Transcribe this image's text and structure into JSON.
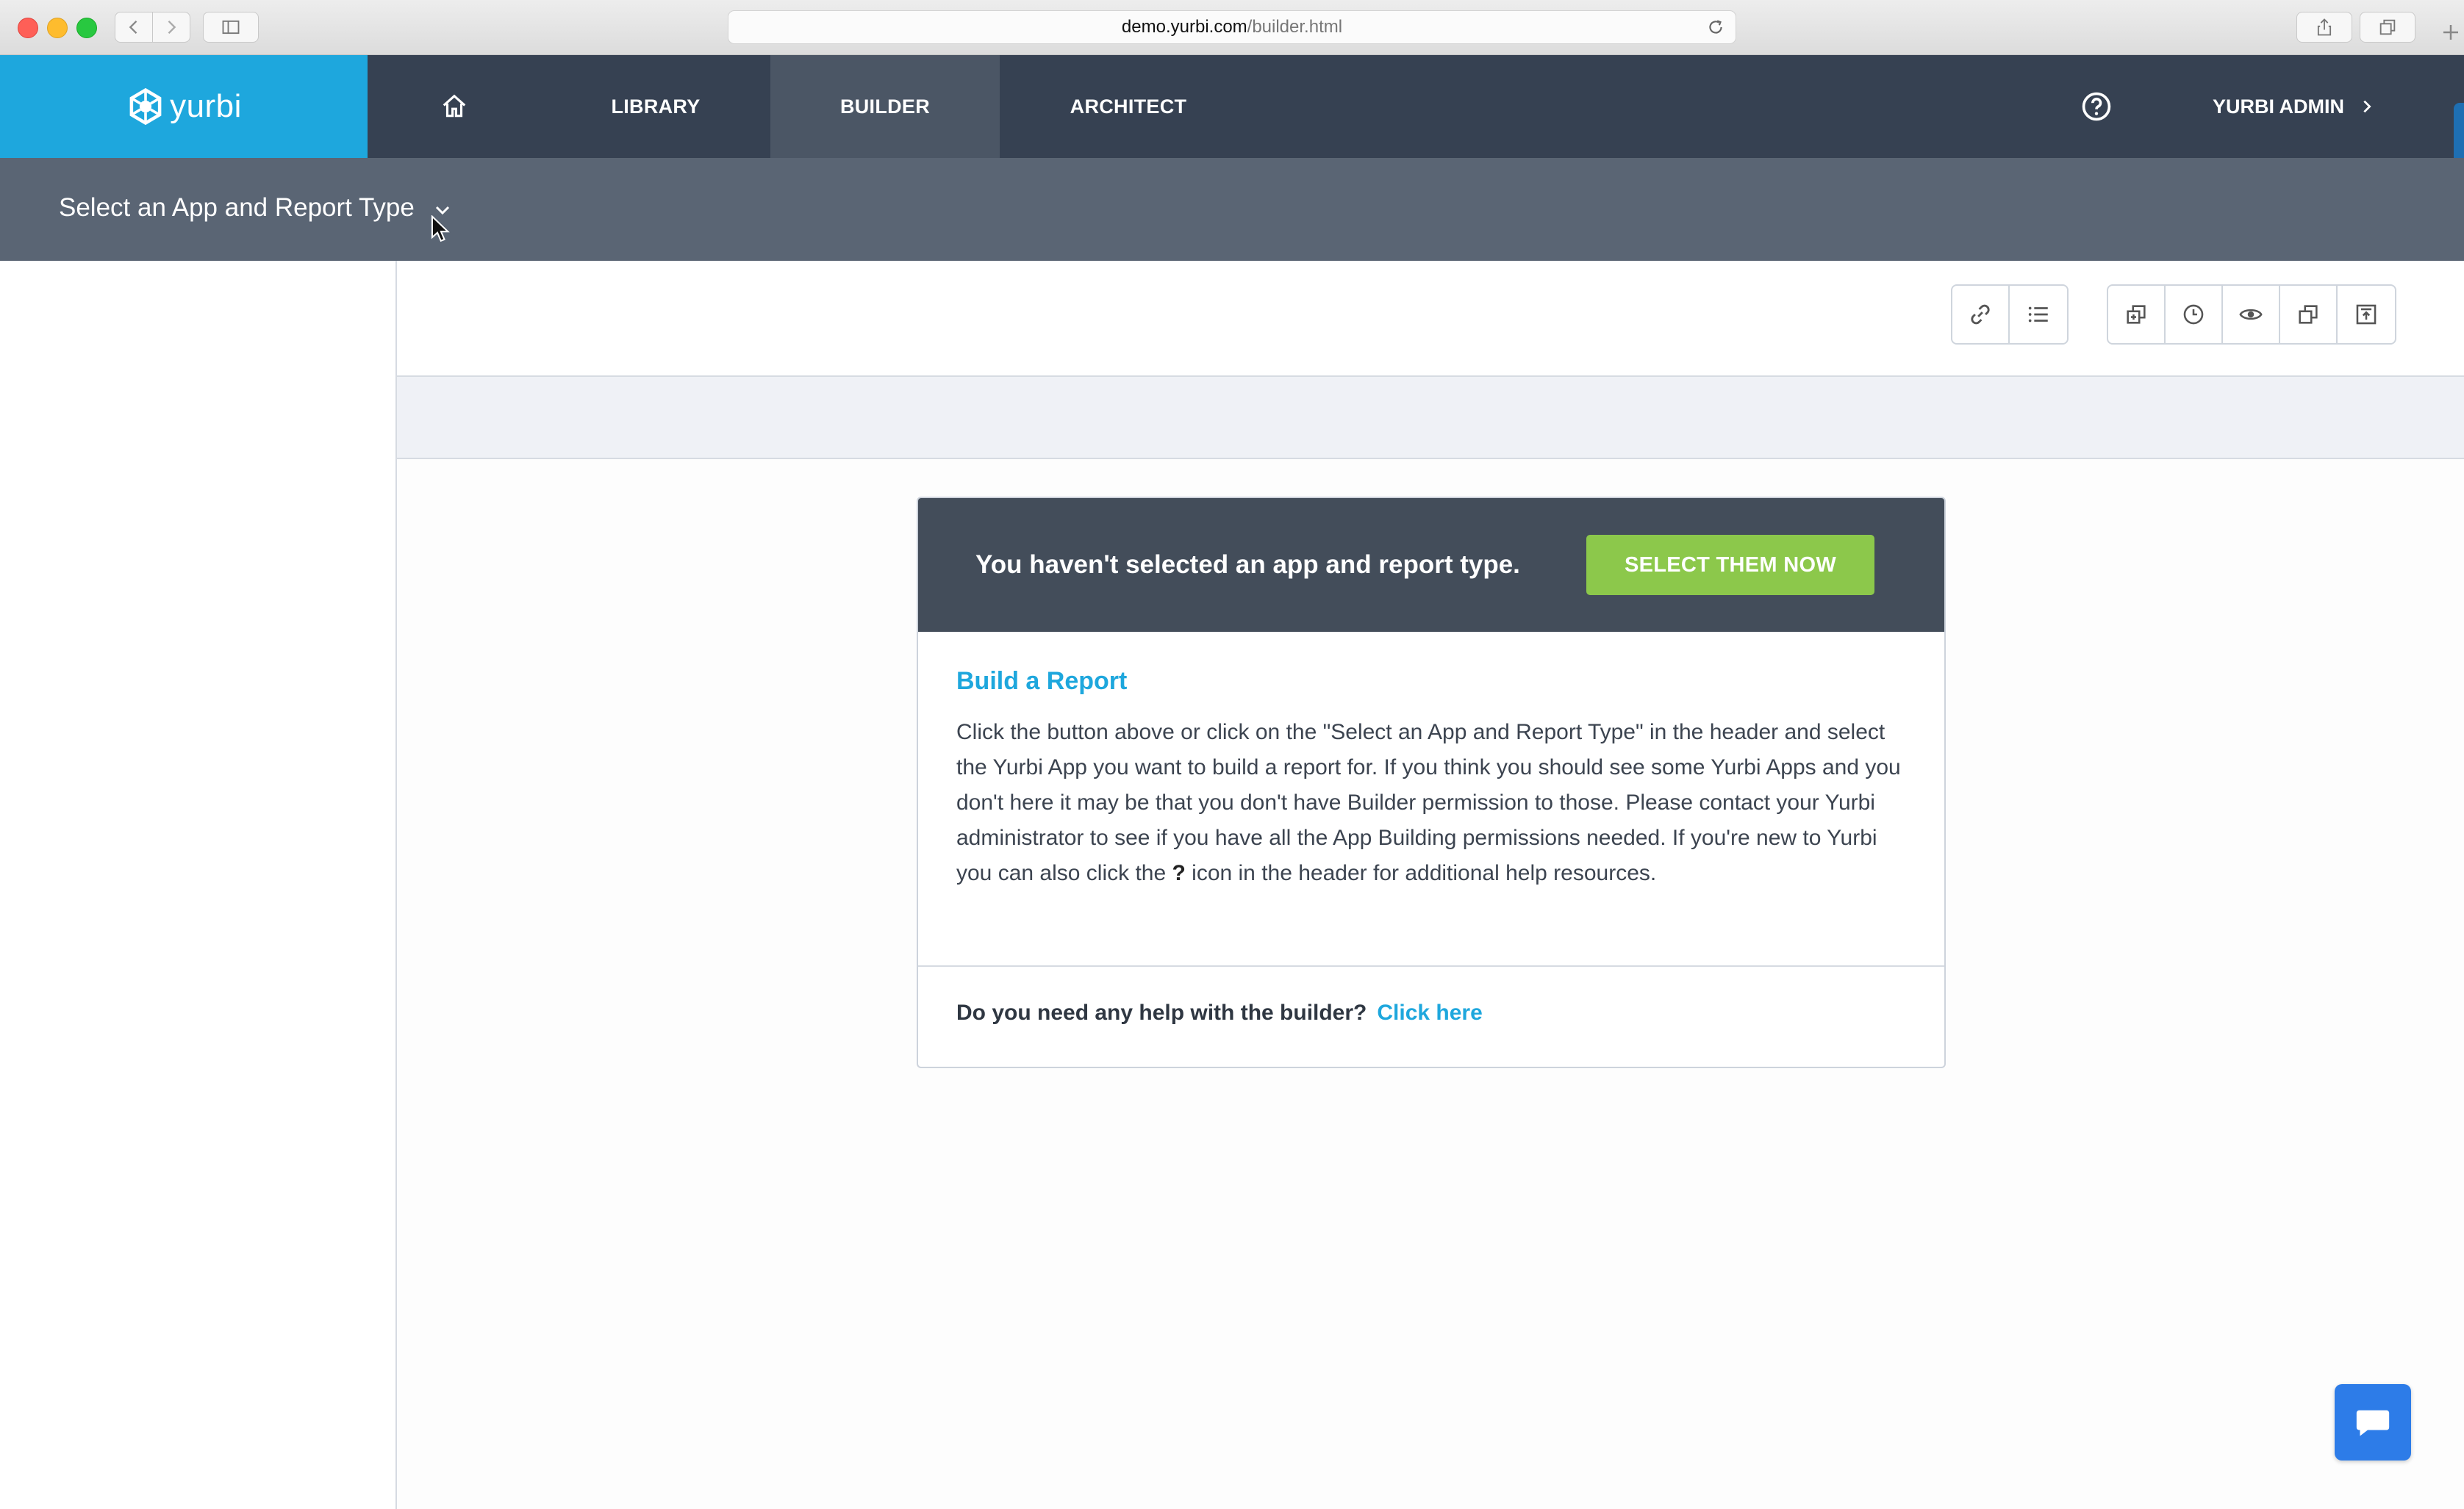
{
  "browser": {
    "url_domain": "demo.yurbi.com",
    "url_path": "/builder.html"
  },
  "nav": {
    "logo_text": "yurbi",
    "items": [
      {
        "label": "LIBRARY"
      },
      {
        "label": "BUILDER"
      },
      {
        "label": "ARCHITECT"
      }
    ],
    "active": "BUILDER",
    "user_label": "YURBI ADMIN"
  },
  "subheader": {
    "selector_label": "Select an App and Report Type"
  },
  "notice": {
    "message": "You haven't selected an app and report type.",
    "button_label": "SELECT THEM NOW"
  },
  "card": {
    "title": "Build a Report",
    "body_part1": "Click the button above or click on the \"Select an App and Report Type\" in the header and select the Yurbi App you want to build a report for. If you think you should see some Yurbi Apps and you don't here it may be that you don't have Builder permission to those. Please contact your Yurbi administrator to see if you have all the App Building permissions needed. If you're new to Yurbi you can also click the ",
    "body_bold": "?",
    "body_part2": " icon in the header for additional help resources.",
    "help_question": "Do you need any help with the builder?",
    "help_link": "Click here"
  },
  "colors": {
    "accent": "#1ea7dd",
    "nav_bg": "#364152",
    "cta_green": "#8cc84b"
  }
}
